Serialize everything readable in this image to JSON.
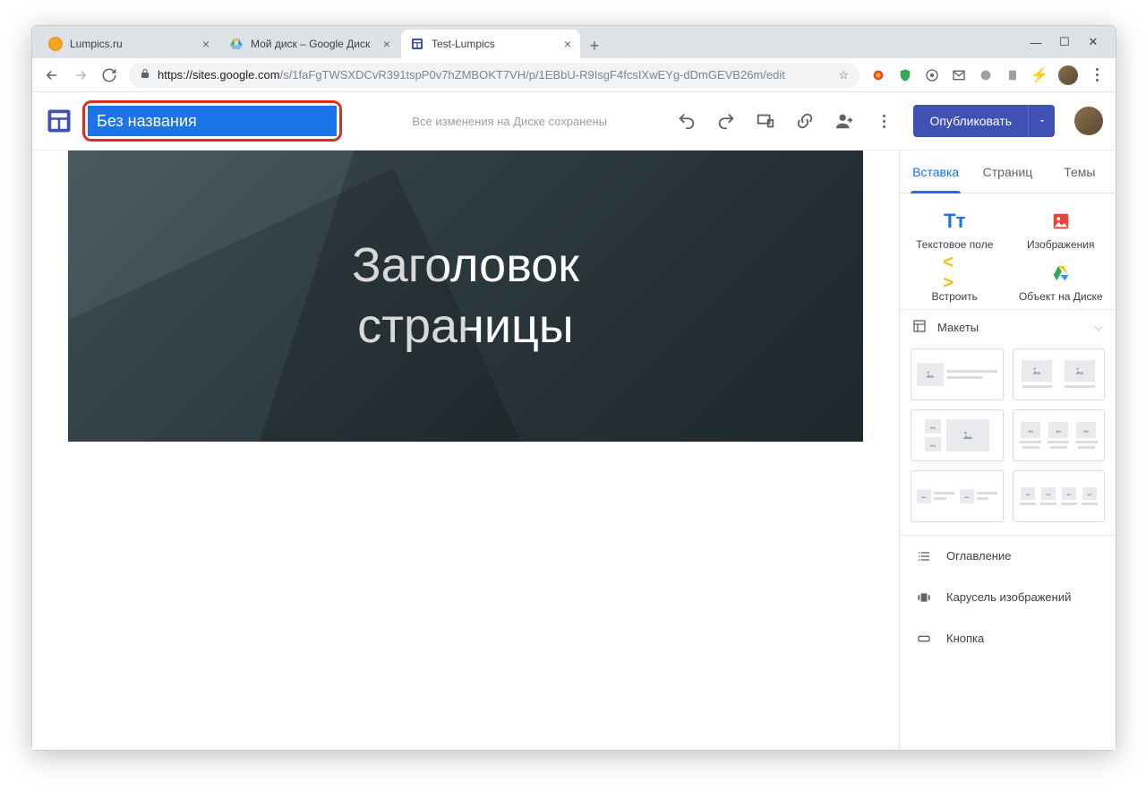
{
  "browser": {
    "tabs": [
      {
        "title": "Lumpics.ru",
        "active": false,
        "favicon": "lumpics"
      },
      {
        "title": "Мой диск – Google Диск",
        "active": false,
        "favicon": "drive"
      },
      {
        "title": "Test-Lumpics",
        "active": true,
        "favicon": "sites"
      }
    ],
    "url_host": "https://sites.google.com",
    "url_path": "/s/1faFgTWSXDCvR391tspP0v7hZMBOKT7VH/p/1EBbU-R9IsgF4fcsIXwEYg-dDmGEVB26m/edit"
  },
  "appbar": {
    "title_value": "Без названия",
    "save_status": "Все изменения на Диске сохранены",
    "publish_label": "Опубликовать"
  },
  "page": {
    "hero_title": "Заголовок\nстраницы"
  },
  "sidepanel": {
    "tabs": {
      "insert": "Вставка",
      "pages": "Страниц",
      "themes": "Темы"
    },
    "insert_items": {
      "textbox": "Текстовое поле",
      "images": "Изображения",
      "embed": "Встроить",
      "drive": "Объект на Диске"
    },
    "layouts_label": "Макеты",
    "more": {
      "toc": "Оглавление",
      "carousel": "Карусель изображений",
      "button": "Кнопка"
    }
  },
  "colors": {
    "accent": "#1a73e8",
    "publish": "#3f51b5",
    "highlight_border": "#d93025"
  }
}
